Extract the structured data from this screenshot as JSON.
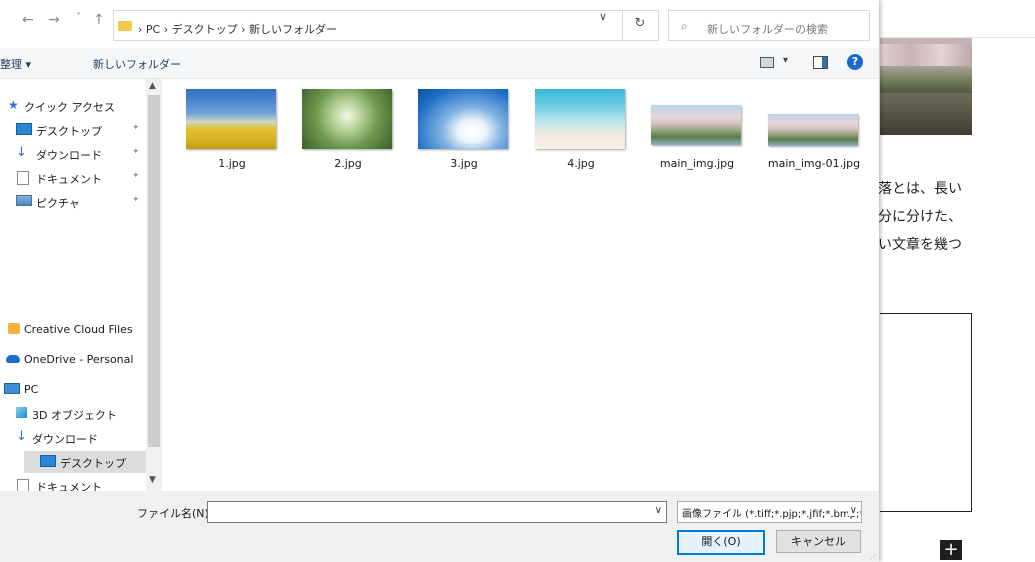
{
  "nav": {
    "back": "←",
    "forward": "→",
    "recent": "˅",
    "up": "↑"
  },
  "address": {
    "crumbs": "› PC › デスクトップ › 新しいフォルダー",
    "dropdown": "∨",
    "refresh": "↻"
  },
  "search": {
    "placeholder": "新しいフォルダーの検索"
  },
  "toolbar": {
    "organize": "整理 ▾",
    "new_folder": "新しいフォルダー",
    "view_dd": "▾",
    "help": "?"
  },
  "sidebar": {
    "items": [
      {
        "label": "クイック アクセス",
        "icon": "star-icon"
      },
      {
        "label": "デスクトップ",
        "icon": "desktop-icon",
        "pinned": true
      },
      {
        "label": "ダウンロード",
        "icon": "download-icon",
        "pinned": true
      },
      {
        "label": "ドキュメント",
        "icon": "document-icon",
        "pinned": true
      },
      {
        "label": "ピクチャ",
        "icon": "pictures-icon",
        "pinned": true
      },
      {
        "label": "Creative Cloud Files",
        "icon": "creative-cloud-icon"
      },
      {
        "label": "OneDrive - Personal",
        "icon": "onedrive-icon"
      },
      {
        "label": "PC",
        "icon": "pc-icon"
      },
      {
        "label": "3D オブジェクト",
        "icon": "3d-objects-icon"
      },
      {
        "label": "ダウンロード",
        "icon": "download-icon"
      },
      {
        "label": "デスクトップ",
        "icon": "desktop-icon",
        "selected": true
      },
      {
        "label": "ドキュメント",
        "icon": "document-icon"
      }
    ]
  },
  "files": [
    {
      "name": "1.jpg"
    },
    {
      "name": "2.jpg"
    },
    {
      "name": "3.jpg"
    },
    {
      "name": "4.jpg"
    },
    {
      "name": "main_img.jpg"
    },
    {
      "name": "main_img-01.jpg"
    }
  ],
  "footer": {
    "filename_label": "ファイル名(N):",
    "filename_value": "",
    "dd": "∨",
    "filetype": "画像ファイル (*.tiff;*.pjp;*.jfif;*.bmp;*.gif;*.svg;*.png)",
    "open": "開く(O)",
    "cancel": "キャンセル"
  },
  "background": {
    "line1": "落とは、長い",
    "line2": "分に分けた、",
    "line3": "い文章を幾つ",
    "plus": "+"
  },
  "scroll": {
    "up": "▲",
    "down": "▼"
  },
  "pin": "📌"
}
